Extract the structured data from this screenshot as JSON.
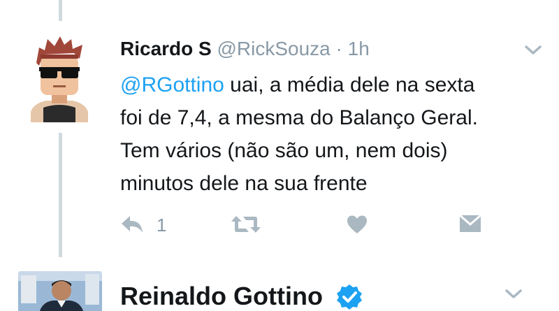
{
  "tweet": {
    "author_name": "Ricardo S",
    "author_handle": "@RickSouza",
    "separator": "·",
    "time": "1h",
    "mention": "@RGottino",
    "text_line1_rest": " uai, a média dele na sexta",
    "text_line2": "foi de 7,4, a mesma do Balanço Geral.",
    "text_line3": "Tem vários (não são um, nem dois)",
    "text_line4": "minutos dele na sua frente",
    "reply_count": "1",
    "icons": [
      "reply-icon",
      "retweet-icon",
      "like-icon",
      "direct-message-icon",
      "chevron-down-icon"
    ]
  },
  "next_tweet": {
    "author_name": "Reinaldo Gottino",
    "verified": true,
    "icons": [
      "verified-badge-icon",
      "chevron-down-icon"
    ]
  },
  "colors": {
    "link_blue": "#1da1f2",
    "muted_gray": "#8899a6",
    "icon_gray": "#aab8c2",
    "thread_line": "#cfd9de",
    "text": "#14171a"
  }
}
